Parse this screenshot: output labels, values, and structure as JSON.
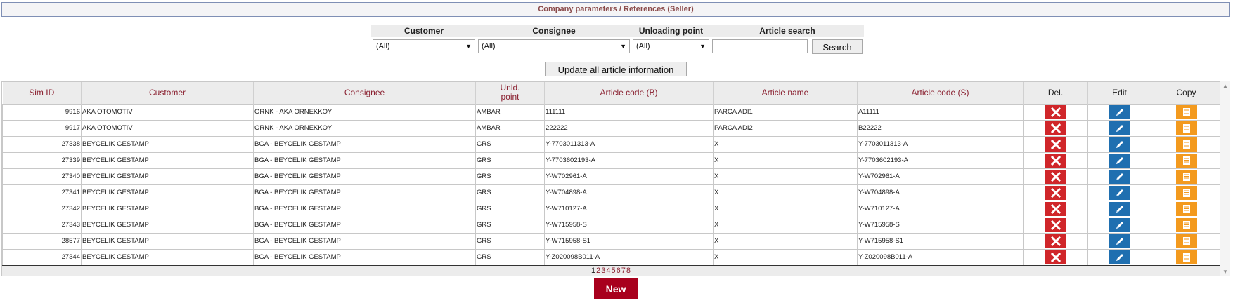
{
  "breadcrumb": {
    "part1": "Company parameters",
    "separator": " / ",
    "part2": "References (Seller)"
  },
  "filters": {
    "customer": {
      "label": "Customer",
      "value": "(All)"
    },
    "consignee": {
      "label": "Consignee",
      "value": "(All)"
    },
    "unloading": {
      "label": "Unloading point",
      "value": "(All)"
    },
    "article_search": {
      "label": "Article search",
      "value": ""
    },
    "search_label": "Search"
  },
  "update_label": "Update all article information",
  "columns": {
    "sim_id": "Sim ID",
    "customer": "Customer",
    "consignee": "Consignee",
    "unld_1": "Unld.",
    "unld_2": "point",
    "article_code_b": "Article code (B)",
    "article_name": "Article name",
    "article_code_s": "Article code (S)",
    "del": "Del.",
    "edit": "Edit",
    "copy": "Copy"
  },
  "rows": [
    {
      "sim_id": "9916",
      "customer": "AKA OTOMOTIV",
      "consignee": "ORNK - AKA ORNEKKOY",
      "unld": "AMBAR",
      "code_b": "111111",
      "name": "PARCA ADI1",
      "code_s": "A11111"
    },
    {
      "sim_id": "9917",
      "customer": "AKA OTOMOTIV",
      "consignee": "ORNK - AKA ORNEKKOY",
      "unld": "AMBAR",
      "code_b": "222222",
      "name": "PARCA ADI2",
      "code_s": "B22222"
    },
    {
      "sim_id": "27338",
      "customer": "BEYCELIK GESTAMP",
      "consignee": "BGA - BEYCELIK GESTAMP",
      "unld": "GRS",
      "code_b": "Y-7703011313-A",
      "name": "X",
      "code_s": "Y-7703011313-A"
    },
    {
      "sim_id": "27339",
      "customer": "BEYCELIK GESTAMP",
      "consignee": "BGA - BEYCELIK GESTAMP",
      "unld": "GRS",
      "code_b": "Y-7703602193-A",
      "name": "X",
      "code_s": "Y-7703602193-A"
    },
    {
      "sim_id": "27340",
      "customer": "BEYCELIK GESTAMP",
      "consignee": "BGA - BEYCELIK GESTAMP",
      "unld": "GRS",
      "code_b": "Y-W702961-A",
      "name": "X",
      "code_s": "Y-W702961-A"
    },
    {
      "sim_id": "27341",
      "customer": "BEYCELIK GESTAMP",
      "consignee": "BGA - BEYCELIK GESTAMP",
      "unld": "GRS",
      "code_b": "Y-W704898-A",
      "name": "X",
      "code_s": "Y-W704898-A"
    },
    {
      "sim_id": "27342",
      "customer": "BEYCELIK GESTAMP",
      "consignee": "BGA - BEYCELIK GESTAMP",
      "unld": "GRS",
      "code_b": "Y-W710127-A",
      "name": "X",
      "code_s": "Y-W710127-A"
    },
    {
      "sim_id": "27343",
      "customer": "BEYCELIK GESTAMP",
      "consignee": "BGA - BEYCELIK GESTAMP",
      "unld": "GRS",
      "code_b": "Y-W715958-S",
      "name": "X",
      "code_s": "Y-W715958-S"
    },
    {
      "sim_id": "28577",
      "customer": "BEYCELIK GESTAMP",
      "consignee": "BGA - BEYCELIK GESTAMP",
      "unld": "GRS",
      "code_b": "Y-W715958-S1",
      "name": "X",
      "code_s": "Y-W715958-S1"
    },
    {
      "sim_id": "27344",
      "customer": "BEYCELIK GESTAMP",
      "consignee": "BGA - BEYCELIK GESTAMP",
      "unld": "GRS",
      "code_b": "Y-Z020098B011-A",
      "name": "X",
      "code_s": "Y-Z020098B011-A"
    }
  ],
  "pager": [
    "1",
    "2",
    "3",
    "4",
    "5",
    "6",
    "7",
    "8"
  ],
  "new_label": "New",
  "colors": {
    "accent": "#a8001d",
    "header_text": "#8a2030",
    "delete": "#d0262a",
    "edit": "#1f6fb0",
    "copy": "#f39a1e"
  }
}
